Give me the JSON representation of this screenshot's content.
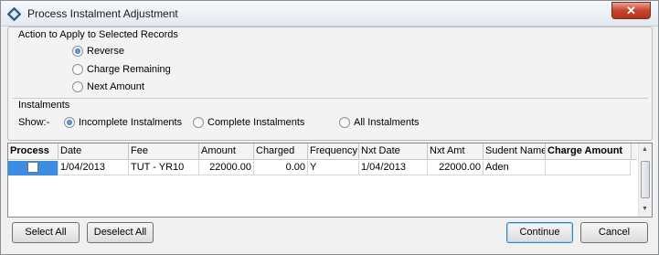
{
  "window": {
    "title": "Process Instalment Adjustment",
    "close_label": "✕"
  },
  "action_group": {
    "label": "Action to Apply to Selected Records",
    "options": [
      {
        "label": "Reverse",
        "selected": true
      },
      {
        "label": "Charge Remaining",
        "selected": false
      },
      {
        "label": "Next Amount",
        "selected": false
      }
    ]
  },
  "instalments_group": {
    "label": "Instalments",
    "show_label": "Show:-",
    "options": [
      {
        "label": "Incomplete Instalments",
        "selected": true
      },
      {
        "label": "Complete Instalments",
        "selected": false
      },
      {
        "label": "All Instalments",
        "selected": false
      }
    ]
  },
  "table": {
    "columns": [
      "Process",
      "Date",
      "Fee",
      "Amount",
      "Charged",
      "Frequency",
      "Nxt Date",
      "Nxt Amt",
      "Sudent Name",
      "Charge Amount"
    ],
    "rows": [
      {
        "process": false,
        "date": "1/04/2013",
        "fee": "TUT - YR10",
        "amount": "22000.00",
        "charged": "0.00",
        "frequency": "Y",
        "nxt_date": "1/04/2013",
        "nxt_amt": "22000.00",
        "student_name": "Aden",
        "charge_amount": ""
      }
    ]
  },
  "buttons": {
    "select_all": "Select All",
    "deselect_all": "Deselect All",
    "continue": "Continue",
    "cancel": "Cancel"
  },
  "colors": {
    "selection": "#3d8ee2",
    "close": "#c7432c"
  }
}
